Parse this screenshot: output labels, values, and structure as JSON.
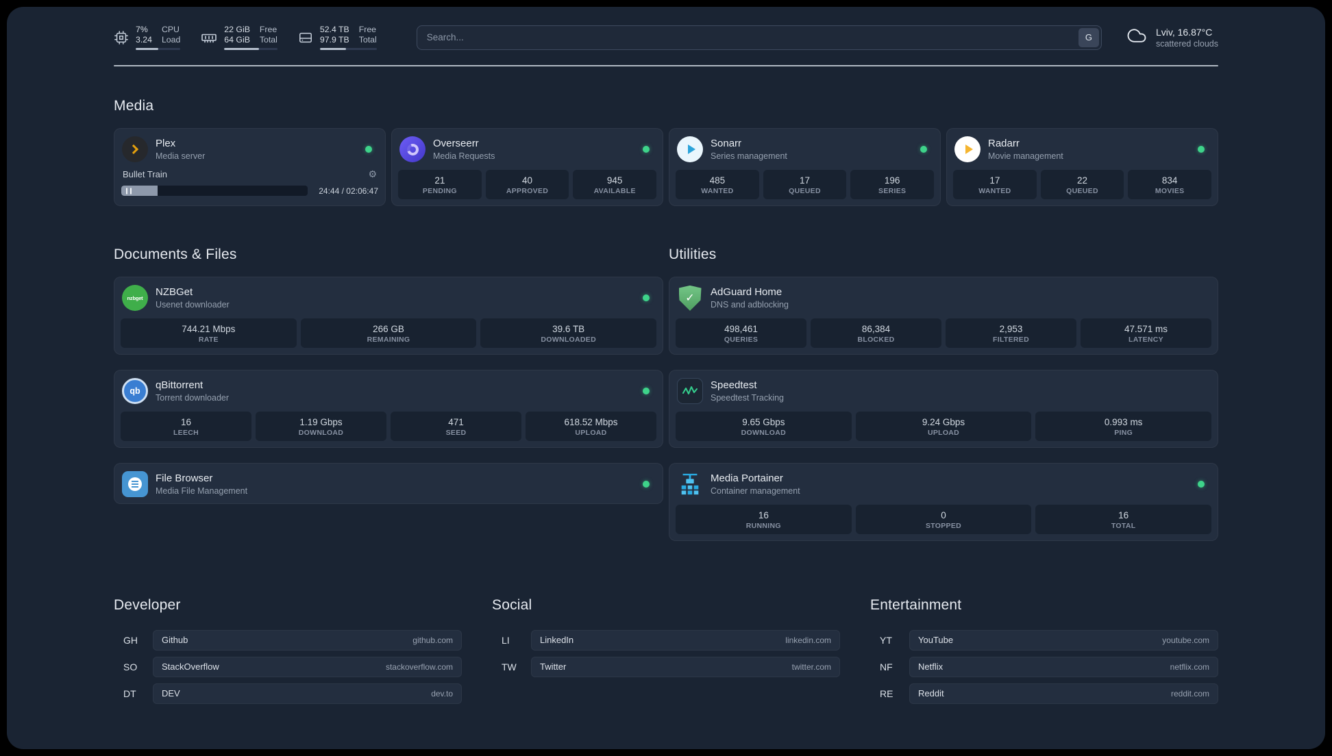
{
  "colors": {
    "background": "#1a2433",
    "card": "#232e3f",
    "status_online": "#3ed38a",
    "plex_amber": "#e5a00d",
    "speedtest_green": "#35d08e",
    "portainer_blue": "#29abe2"
  },
  "topbar": {
    "cpu": {
      "value_top": "7%",
      "value_bottom": "3.24",
      "label_top": "CPU",
      "label_bottom": "Load",
      "bar_percent": 50
    },
    "memory": {
      "value_top": "22 GiB",
      "value_bottom": "64 GiB",
      "label_top": "Free",
      "label_bottom": "Total",
      "bar_percent": 66
    },
    "disk": {
      "value_top": "52.4 TB",
      "value_bottom": "97.9 TB",
      "label_top": "Free",
      "label_bottom": "Total",
      "bar_percent": 46
    },
    "search": {
      "placeholder": "Search...",
      "button": "G"
    },
    "weather": {
      "location": "Lviv, 16.87°C",
      "condition": "scattered clouds"
    }
  },
  "sections": {
    "media": {
      "title": "Media",
      "cards": [
        {
          "name": "Plex",
          "subtitle": "Media server",
          "status": "online",
          "player": {
            "track": "Bullet Train",
            "time": "24:44 / 02:06:47",
            "progress_percent": 19.5
          }
        },
        {
          "name": "Overseerr",
          "subtitle": "Media Requests",
          "status": "online",
          "stats": [
            {
              "value": "21",
              "label": "PENDING"
            },
            {
              "value": "40",
              "label": "APPROVED"
            },
            {
              "value": "945",
              "label": "AVAILABLE"
            }
          ]
        },
        {
          "name": "Sonarr",
          "subtitle": "Series management",
          "status": "online",
          "stats": [
            {
              "value": "485",
              "label": "WANTED"
            },
            {
              "value": "17",
              "label": "QUEUED"
            },
            {
              "value": "196",
              "label": "SERIES"
            }
          ]
        },
        {
          "name": "Radarr",
          "subtitle": "Movie management",
          "status": "online",
          "stats": [
            {
              "value": "17",
              "label": "WANTED"
            },
            {
              "value": "22",
              "label": "QUEUED"
            },
            {
              "value": "834",
              "label": "MOVIES"
            }
          ]
        }
      ]
    },
    "documents": {
      "title": "Documents & Files",
      "cards": [
        {
          "name": "NZBGet",
          "subtitle": "Usenet downloader",
          "status": "online",
          "icon_text": "nzbget",
          "stats": [
            {
              "value": "744.21 Mbps",
              "label": "RATE"
            },
            {
              "value": "266 GB",
              "label": "REMAINING"
            },
            {
              "value": "39.6 TB",
              "label": "DOWNLOADED"
            }
          ]
        },
        {
          "name": "qBittorrent",
          "subtitle": "Torrent downloader",
          "status": "online",
          "icon_text": "qb",
          "stats": [
            {
              "value": "16",
              "label": "LEECH"
            },
            {
              "value": "1.19 Gbps",
              "label": "DOWNLOAD"
            },
            {
              "value": "471",
              "label": "SEED"
            },
            {
              "value": "618.52 Mbps",
              "label": "UPLOAD"
            }
          ]
        },
        {
          "name": "File Browser",
          "subtitle": "Media File Management",
          "status": "online"
        }
      ]
    },
    "utilities": {
      "title": "Utilities",
      "cards": [
        {
          "name": "AdGuard Home",
          "subtitle": "DNS and adblocking",
          "icon_text": "✓",
          "stats": [
            {
              "value": "498,461",
              "label": "QUERIES"
            },
            {
              "value": "86,384",
              "label": "BLOCKED"
            },
            {
              "value": "2,953",
              "label": "FILTERED"
            },
            {
              "value": "47.571 ms",
              "label": "LATENCY"
            }
          ]
        },
        {
          "name": "Speedtest",
          "subtitle": "Speedtest Tracking",
          "stats": [
            {
              "value": "9.65 Gbps",
              "label": "DOWNLOAD"
            },
            {
              "value": "9.24 Gbps",
              "label": "UPLOAD"
            },
            {
              "value": "0.993 ms",
              "label": "PING"
            }
          ]
        },
        {
          "name": "Media Portainer",
          "subtitle": "Container management",
          "status": "online",
          "stats": [
            {
              "value": "16",
              "label": "RUNNING"
            },
            {
              "value": "0",
              "label": "STOPPED"
            },
            {
              "value": "16",
              "label": "TOTAL"
            }
          ]
        }
      ]
    }
  },
  "bookmark_groups": [
    {
      "title": "Developer",
      "items": [
        {
          "abbr": "GH",
          "name": "Github",
          "url": "github.com"
        },
        {
          "abbr": "SO",
          "name": "StackOverflow",
          "url": "stackoverflow.com"
        },
        {
          "abbr": "DT",
          "name": "DEV",
          "url": "dev.to"
        }
      ]
    },
    {
      "title": "Social",
      "items": [
        {
          "abbr": "LI",
          "name": "LinkedIn",
          "url": "linkedin.com"
        },
        {
          "abbr": "TW",
          "name": "Twitter",
          "url": "twitter.com"
        }
      ]
    },
    {
      "title": "Entertainment",
      "items": [
        {
          "abbr": "YT",
          "name": "YouTube",
          "url": "youtube.com"
        },
        {
          "abbr": "NF",
          "name": "Netflix",
          "url": "netflix.com"
        },
        {
          "abbr": "RE",
          "name": "Reddit",
          "url": "reddit.com"
        }
      ]
    }
  ]
}
